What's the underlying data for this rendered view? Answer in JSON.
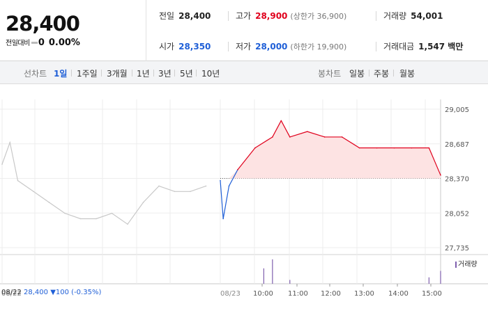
{
  "summary": {
    "price": "28,400",
    "change_label": "전일대비",
    "change_value": "0",
    "change_pct": "0.00%"
  },
  "quotes": {
    "prev_close": {
      "label": "전일",
      "value": "28,400"
    },
    "high": {
      "label": "고가",
      "value": "28,900",
      "sub": "(상한가 36,900)"
    },
    "volume": {
      "label": "거래량",
      "value": "54,001"
    },
    "open": {
      "label": "시가",
      "value": "28,350"
    },
    "low": {
      "label": "저가",
      "value": "28,000",
      "sub": "(하한가 19,900)"
    },
    "amount": {
      "label": "거래대금",
      "value": "1,547 백만"
    }
  },
  "toolbar": {
    "line_label": "선차트",
    "line_periods": [
      "1일",
      "1주일",
      "3개월",
      "1년",
      "3년",
      "5년",
      "10년"
    ],
    "active_period": "1일",
    "candle_label": "봉차트",
    "candle_periods": [
      "일봉",
      "주봉",
      "월봉"
    ]
  },
  "colors": {
    "up": "#e0001c",
    "down": "#1f5fd7",
    "prev_day_line": "#c8c8c8",
    "volume": "#7f5fae",
    "up_fill": "#fde3e3"
  },
  "chart_data": {
    "type": "line",
    "y_ticks": [
      "29,005",
      "28,687",
      "28,370",
      "28,052",
      "27,735"
    ],
    "ylim": [
      27735,
      29005
    ],
    "baseline": 28370,
    "x_ticks": [
      "08/22",
      "08/23",
      "10:00",
      "11:00",
      "12:00",
      "13:00",
      "14:00",
      "15:00"
    ],
    "volume_legend": "거래량",
    "prev_day_summary": {
      "date": "08/22",
      "close": "28,400",
      "change": "▼100",
      "pct": "(-0.35%)"
    },
    "series": [
      {
        "x": [
          "08/22 09:00",
          "08/22 09:15",
          "08/22 09:30",
          "08/22 10:00",
          "08/22 10:30",
          "08/22 11:00",
          "08/22 11:30",
          "08/22 12:00",
          "08/22 12:30",
          "08/22 13:00",
          "08/22 13:30",
          "08/22 14:00",
          "08/22 14:30",
          "08/22 15:00",
          "08/22 15:30"
        ],
        "values": [
          28500,
          28700,
          28350,
          28250,
          28150,
          28050,
          28000,
          28000,
          28050,
          27950,
          28150,
          28300,
          28250,
          28250,
          28300
        ]
      },
      {
        "x": [
          "08/23 09:00",
          "08/23 09:05",
          "08/23 09:15",
          "08/23 09:30",
          "08/23 10:00",
          "08/23 10:30",
          "08/23 10:45",
          "08/23 11:00",
          "08/23 11:30",
          "08/23 12:00",
          "08/23 12:30",
          "08/23 13:00",
          "08/23 13:30",
          "08/23 14:00",
          "08/23 14:30",
          "08/23 15:00",
          "08/23 15:20"
        ],
        "values": [
          28350,
          28000,
          28300,
          28450,
          28650,
          28750,
          28900,
          28750,
          28800,
          28750,
          28750,
          28650,
          28650,
          28650,
          28650,
          28650,
          28400
        ]
      }
    ],
    "volume": [
      {
        "x": "08/23 10:30",
        "level": 0.95
      },
      {
        "x": "08/23 10:15",
        "level": 0.6
      },
      {
        "x": "08/23 15:20",
        "level": 0.5
      },
      {
        "x": "08/23 15:00",
        "level": 0.25
      },
      {
        "x": "08/23 11:00",
        "level": 0.15
      }
    ]
  }
}
